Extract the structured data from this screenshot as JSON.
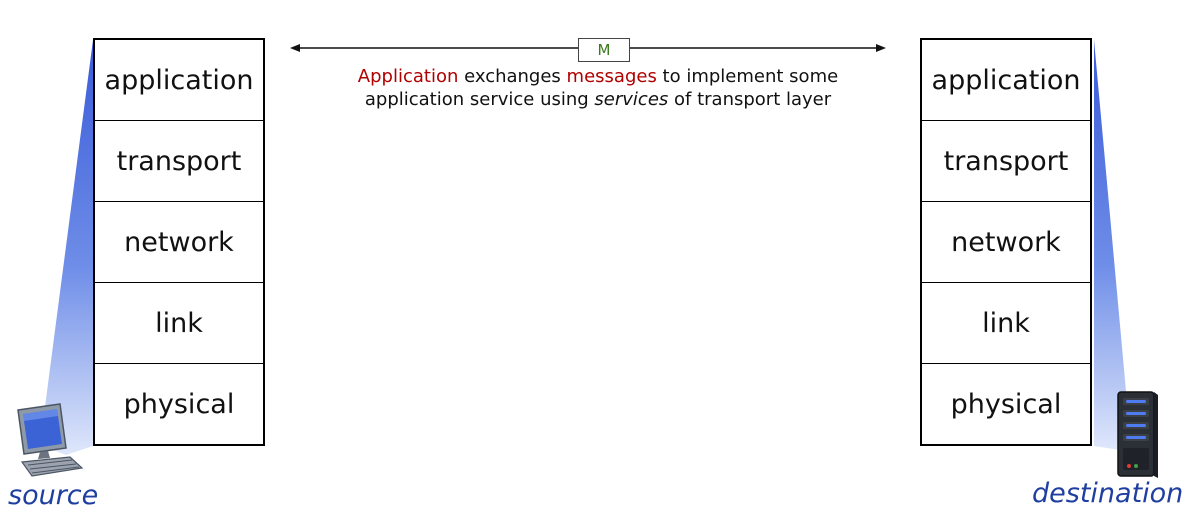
{
  "message_box": {
    "label": "M"
  },
  "caption": {
    "line1_part1": "Application",
    "line1_part2": " exchanges ",
    "line1_part3": "messages",
    "line1_part4": " to implement some",
    "line2_part1": "application service using ",
    "line2_part2": "services",
    "line2_part3": " of transport layer"
  },
  "source_stack": {
    "layers": [
      "application",
      "transport",
      "network",
      "link",
      "physical"
    ]
  },
  "destination_stack": {
    "layers": [
      "application",
      "transport",
      "network",
      "link",
      "physical"
    ]
  },
  "labels": {
    "source": "source",
    "destination": "destination"
  },
  "icons": {
    "source_device": "computer-icon",
    "destination_device": "server-icon"
  },
  "colors": {
    "highlight": "#b00000",
    "message_letter": "#3a7a1c",
    "endpoint_label": "#1f3fa0",
    "beam_blue": "#3a5bd9"
  }
}
